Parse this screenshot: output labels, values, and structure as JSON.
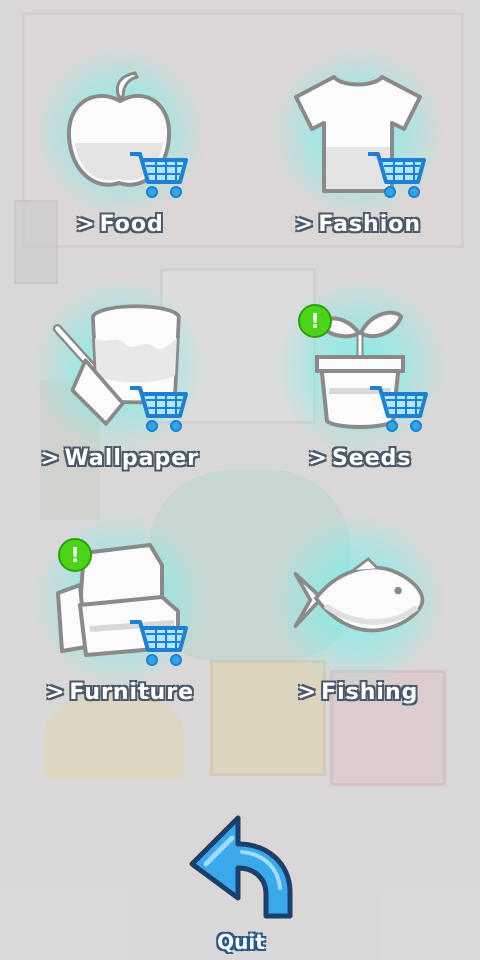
{
  "menu": {
    "items": [
      {
        "id": "food",
        "label": "Food",
        "icon": "apple-icon",
        "shop": true,
        "alert": false
      },
      {
        "id": "fashion",
        "label": "Fashion",
        "icon": "tshirt-icon",
        "shop": true,
        "alert": false
      },
      {
        "id": "wallpaper",
        "label": "Wallpaper",
        "icon": "paint-bucket-icon",
        "shop": true,
        "alert": false
      },
      {
        "id": "seeds",
        "label": "Seeds",
        "icon": "sprout-pot-icon",
        "shop": true,
        "alert": true
      },
      {
        "id": "furniture",
        "label": "Furniture",
        "icon": "sofa-icon",
        "shop": true,
        "alert": true
      },
      {
        "id": "fishing",
        "label": "Fishing",
        "icon": "fish-icon",
        "shop": false,
        "alert": false
      }
    ],
    "chevron": ">",
    "alert_symbol": "!"
  },
  "quit": {
    "label": "Quit",
    "icon": "back-arrow-icon"
  },
  "colors": {
    "glow": "#78f0eb",
    "cart": "#2fa6e8",
    "alert": "#4cd41a",
    "quit_arrow": "#3aa8ea"
  }
}
